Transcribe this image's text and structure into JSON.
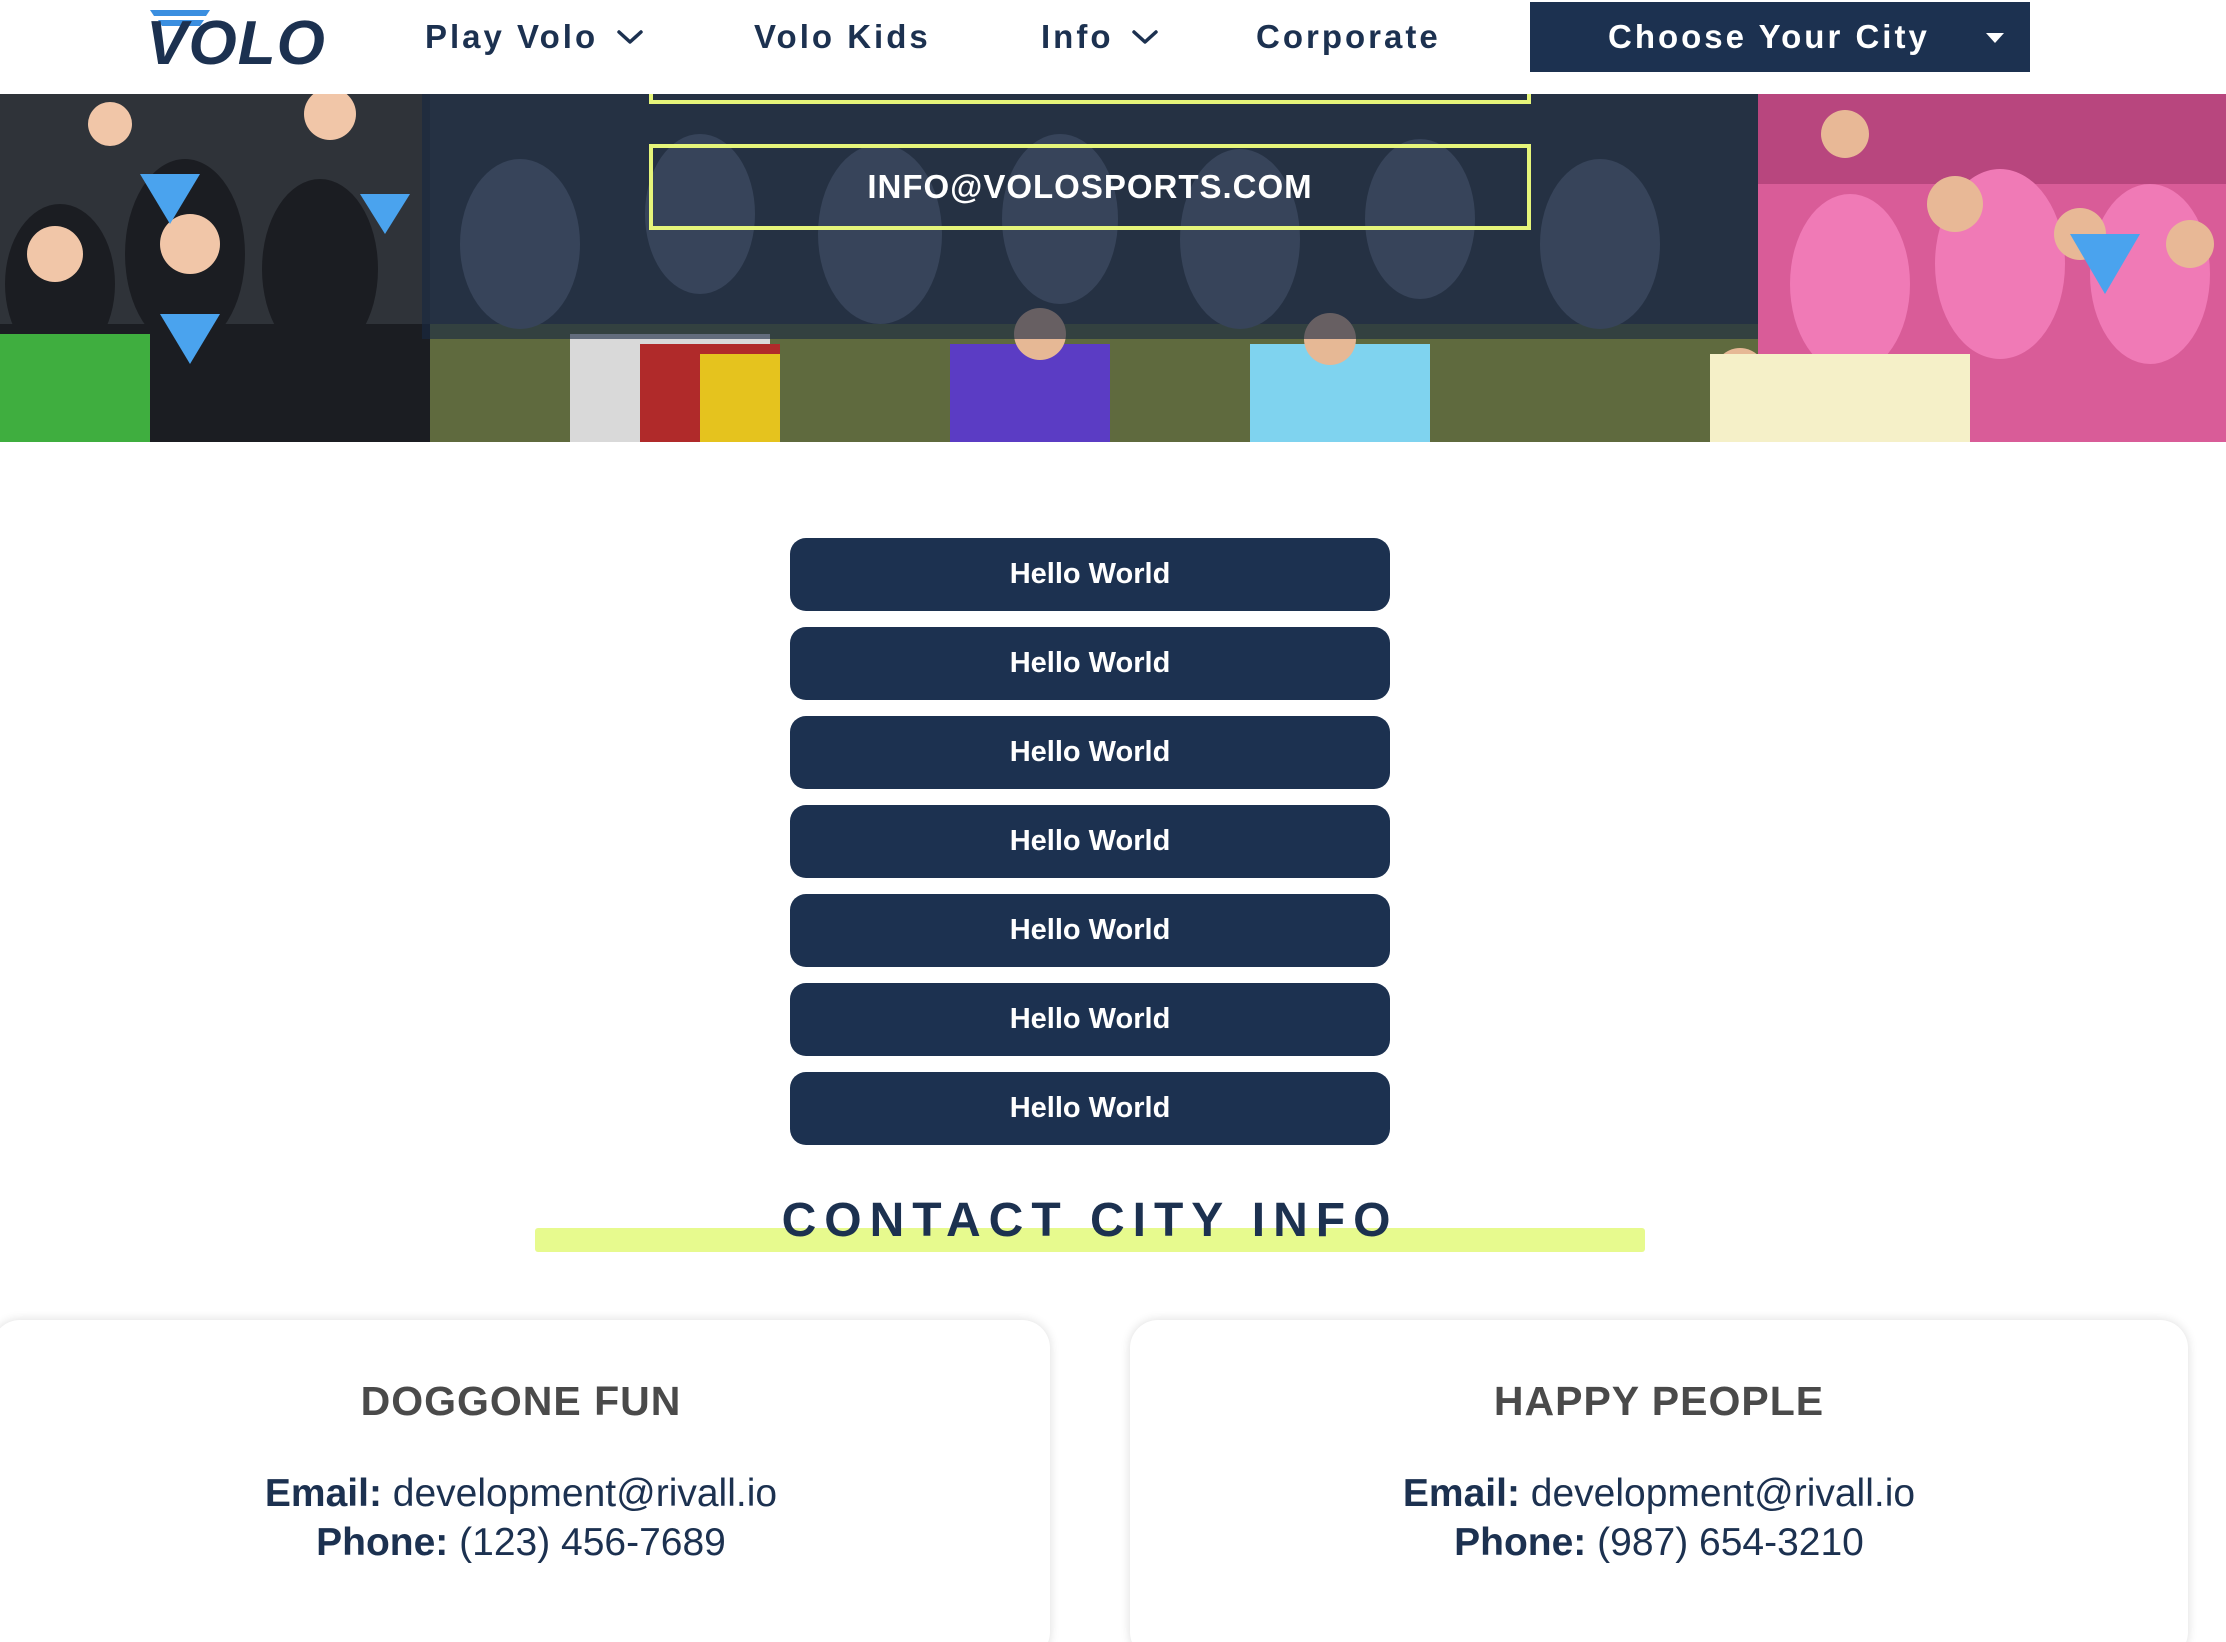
{
  "nav": {
    "logo_text": "VOLO",
    "items": [
      {
        "label": "Play Volo",
        "has_dropdown": true
      },
      {
        "label": "Volo Kids",
        "has_dropdown": false
      },
      {
        "label": "Info",
        "has_dropdown": true
      },
      {
        "label": "Corporate",
        "has_dropdown": false
      }
    ],
    "city_button": {
      "label": "Choose Your City",
      "icon": "caret-down-icon"
    }
  },
  "hero": {
    "email": "INFO@VOLOSPORTS.COM",
    "image": "group photo of volo league players in team shirts"
  },
  "buttons": [
    "Hello World",
    "Hello World",
    "Hello World",
    "Hello World",
    "Hello World",
    "Hello World",
    "Hello World"
  ],
  "contact": {
    "heading": "CONTACT CITY INFO",
    "cards": [
      {
        "title": "DOGGONE FUN",
        "email_label": "Email:",
        "email": "development@rivall.io",
        "phone_label": "Phone:",
        "phone": "(123) 456-7689"
      },
      {
        "title": "HAPPY PEOPLE",
        "email_label": "Email:",
        "email": "development@rivall.io",
        "phone_label": "Phone:",
        "phone": "(987) 654-3210"
      }
    ]
  },
  "colors": {
    "navy": "#1c3150",
    "accent_yellow": "#e6f57a",
    "highlight": "#e7fa8e",
    "logo_blue": "#3b8fe0",
    "card_title": "#4a4a4a"
  }
}
